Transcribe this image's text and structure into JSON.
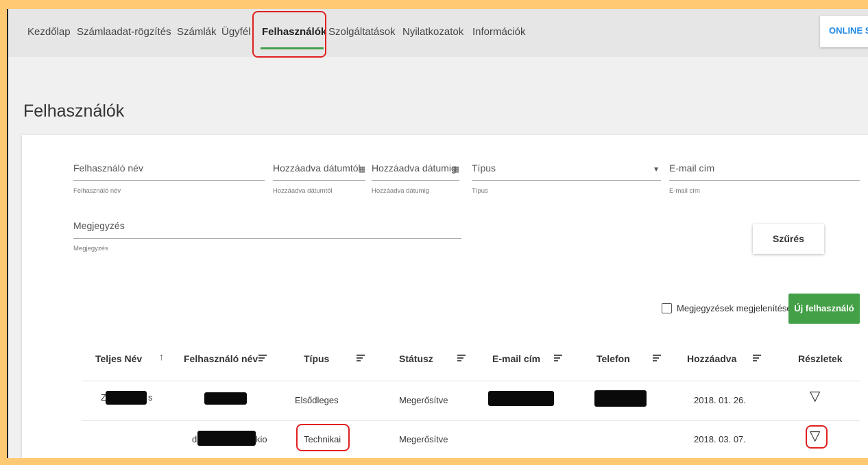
{
  "nav": {
    "items": [
      "Kezdőlap",
      "Számlaadat-rögzítés",
      "Számlák",
      "Ügyfél",
      "Felhasználók",
      "Szolgáltatások",
      "Nyilatkozatok",
      "Információk"
    ],
    "active_index": 4,
    "online_button": "ONLINE SZ"
  },
  "page": {
    "title": "Felhasználók"
  },
  "filters": {
    "username": {
      "label": "Felhasználó név",
      "hint": "Felhasználó név"
    },
    "date_from": {
      "label": "Hozzáadva dátumtól",
      "hint": "Hozzáadva dátumtól"
    },
    "date_to": {
      "label": "Hozzáadva dátumig",
      "hint": "Hozzáadva dátumig"
    },
    "type": {
      "label": "Típus",
      "hint": "Típus"
    },
    "email": {
      "label": "E-mail cím",
      "hint": "E-mail cím"
    },
    "note": {
      "label": "Megjegyzés",
      "hint": "Megjegyzés"
    },
    "filter_button": "Szűrés"
  },
  "actions": {
    "show_notes_label": "Megjegyzések megjelenítése",
    "new_user_button": "Új felhasználó"
  },
  "table": {
    "headers": {
      "full_name": "Teljes Név",
      "username": "Felhasználó név",
      "type": "Típus",
      "status": "Státusz",
      "email": "E-mail cím",
      "phone": "Telefon",
      "added": "Hozzáadva",
      "details": "Részletek"
    },
    "rows": [
      {
        "full_name_visible": "Z",
        "full_name_suffix": "s",
        "username_suffix": "",
        "type": "Elsődleges",
        "status": "Megerősítve",
        "added": "2018. 01. 26."
      },
      {
        "full_name_visible": "",
        "full_name_suffix": "",
        "username_prefix": "d",
        "username_suffix": "kio",
        "type": "Technikai",
        "status": "Megerősítve",
        "added": "2018. 03. 07."
      }
    ]
  },
  "icons": {
    "sort": "arrow-up-icon",
    "column_filter": "filter-lines-icon",
    "calendar": "calendar-icon",
    "dropdown": "dropdown-arrow-icon",
    "details": "triangle-down-outline-icon"
  },
  "colors": {
    "outer_background": "#ffc873",
    "accent_green": "#43a047",
    "link_blue": "#1e88e5",
    "annotation_red": "#e02020"
  }
}
